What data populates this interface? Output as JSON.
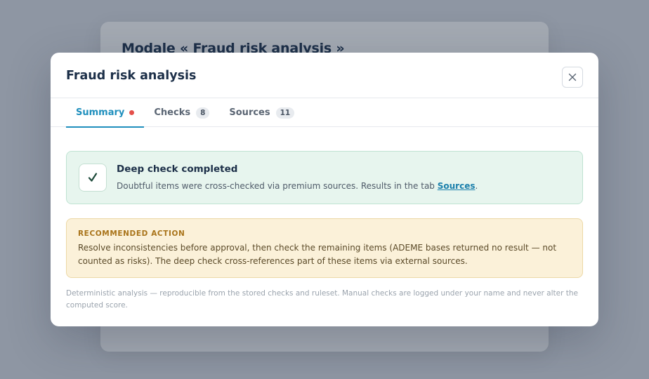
{
  "background": {
    "title": "Modale « Fraud risk analysis »"
  },
  "modal": {
    "title": "Fraud risk analysis",
    "close_icon": "close-icon"
  },
  "tabs": [
    {
      "label": "Summary",
      "active": true,
      "indicator": "red-dot"
    },
    {
      "label": "Checks",
      "count": "8"
    },
    {
      "label": "Sources",
      "count": "11"
    }
  ],
  "success": {
    "icon": "check-icon",
    "title": "Deep check completed",
    "text_before": "Doubtful items were cross-checked via premium sources. Results in the tab ",
    "link": "Sources",
    "text_after": "."
  },
  "warning": {
    "label": "RECOMMENDED ACTION",
    "text": "Resolve inconsistencies before approval, then check the remaining items (ADEME bases returned no result — not counted as risks). The deep check cross-references part of these items via external sources."
  },
  "footnote": "Deterministic analysis — reproducible from the stored checks and ruleset. Manual checks are logged under your name and never alter the computed score.",
  "colors": {
    "accent": "#1f8fbd",
    "success_bg": "#e7f5ee",
    "warning_bg": "#fbf1d9",
    "dot": "#e4504a"
  }
}
